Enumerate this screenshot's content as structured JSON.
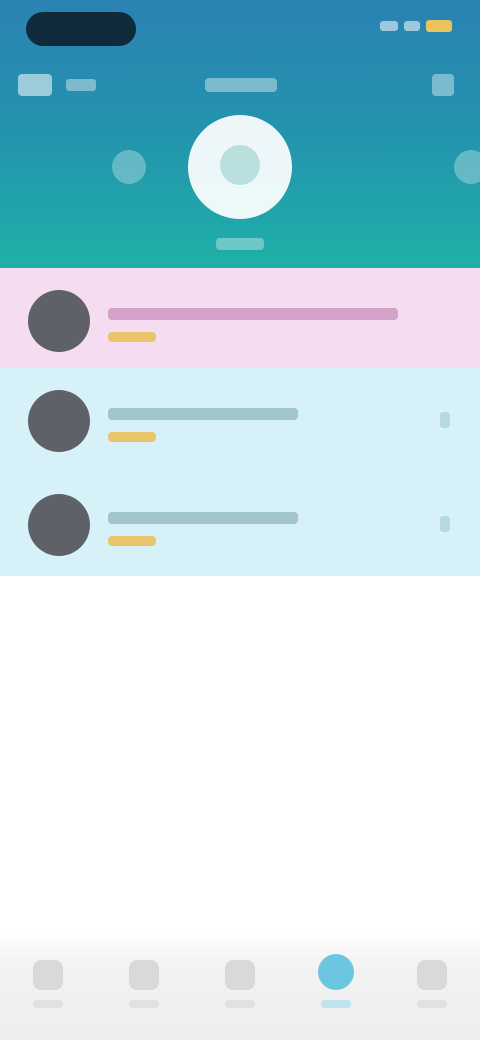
{
  "header": {
    "back_icon": "back-icon",
    "settings_icon": "settings-icon",
    "left_action_icon": "star-icon",
    "right_action_icon": "share-icon",
    "avatar_icon": "profile-avatar-icon"
  },
  "list": {
    "items": [
      {
        "avatar_icon": "user-avatar-icon",
        "highlighted": true
      },
      {
        "avatar_icon": "user-avatar-icon",
        "highlighted": false
      },
      {
        "avatar_icon": "user-avatar-icon",
        "highlighted": false
      }
    ]
  },
  "tabbar": {
    "tabs": [
      {
        "icon": "home-icon"
      },
      {
        "icon": "discover-icon"
      },
      {
        "icon": "chat-icon"
      },
      {
        "icon": "profile-icon",
        "active": true
      },
      {
        "icon": "more-icon"
      }
    ]
  },
  "colors": {
    "header_top": "#2b82b3",
    "header_bottom": "#1fb0a8",
    "row_highlight": "#f6dcf1",
    "row_normal": "#d6f2f8",
    "tab_active": "#6cc6df"
  }
}
